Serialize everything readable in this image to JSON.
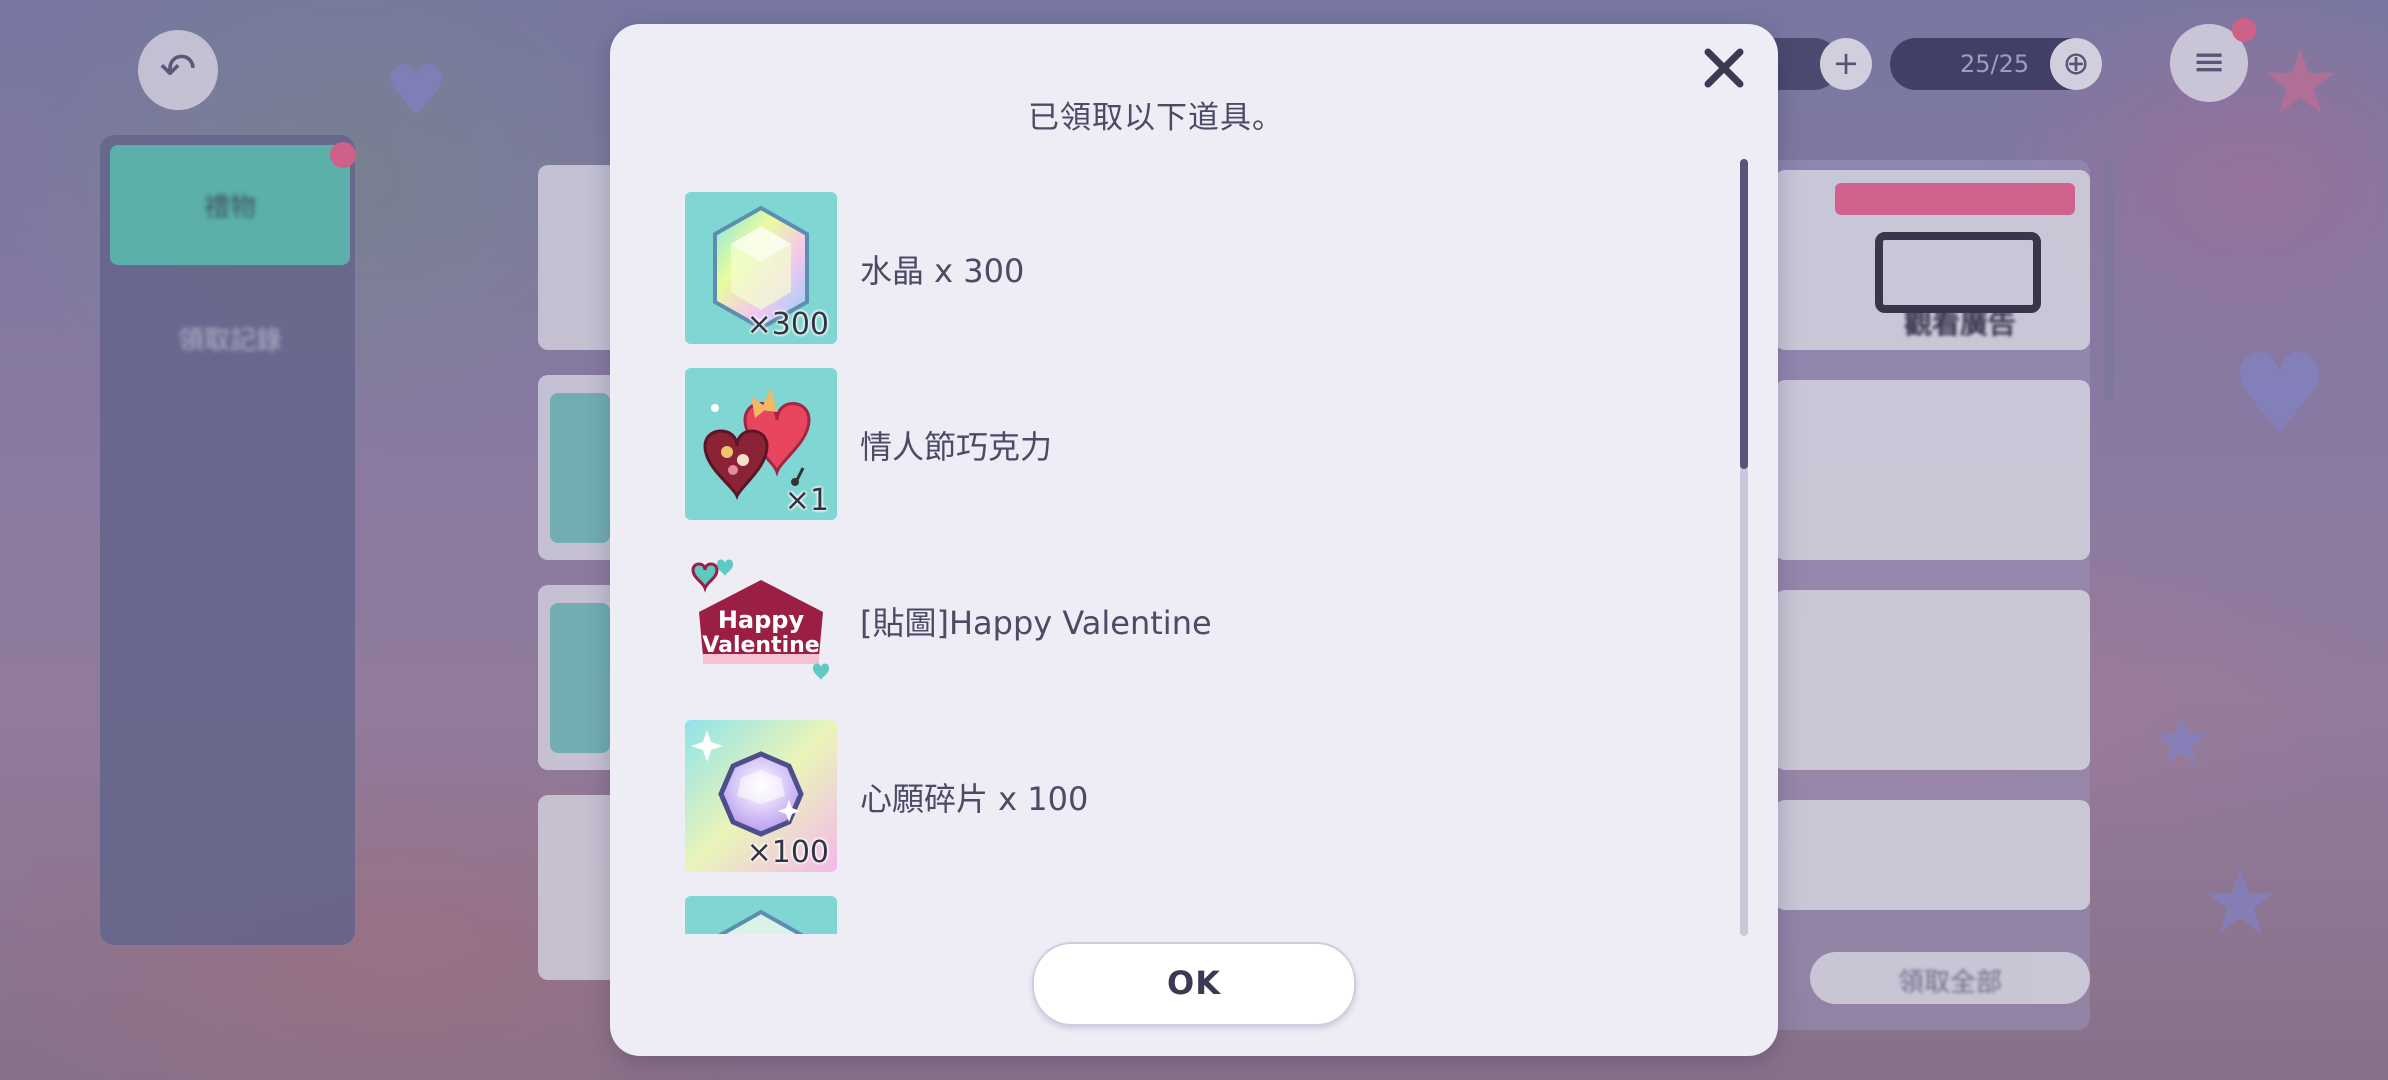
{
  "background": {
    "tabs": [
      "禮物",
      "領取記錄"
    ],
    "right_panel": {
      "tag_text": "",
      "ticket_label": "觀看廣告"
    },
    "claim_all_label": "領取全部",
    "stamina": "25/25"
  },
  "dialog": {
    "title": "已領取以下道具。",
    "items": [
      {
        "icon": "crystal-gem-icon",
        "quantity": "×300",
        "name": "水晶 x 300"
      },
      {
        "icon": "valentine-chocolate-box-icon",
        "quantity": "×1",
        "name": "情人節巧克力"
      },
      {
        "icon": "happy-valentine-sticker-icon",
        "quantity": "",
        "name": "[貼圖]Happy Valentine",
        "sticker_text_1": "Happy",
        "sticker_text_2": "Valentine"
      },
      {
        "icon": "wish-fragment-gem-icon",
        "quantity": "×100",
        "name": "心願碎片 x 100"
      },
      {
        "icon": "crystal-gem-icon",
        "quantity": "",
        "name": ""
      }
    ],
    "ok_label": "OK",
    "scroll_position": 0.0
  },
  "colors": {
    "dialog_bg": "#eeedf5",
    "text": "#4b4b66",
    "teal_tile": "#7fd6d2",
    "pink": "#e56a91"
  }
}
